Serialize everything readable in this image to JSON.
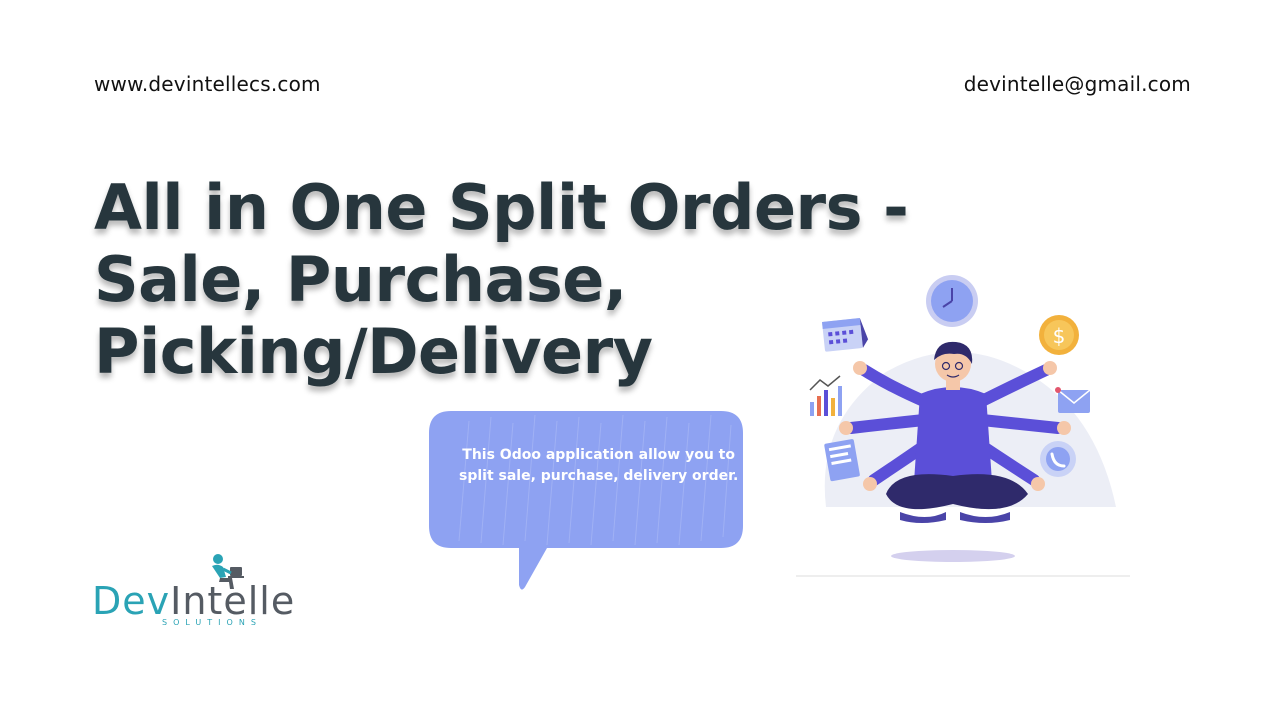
{
  "header": {
    "website": "www.devintellecs.com",
    "email": "devintelle@gmail.com"
  },
  "headline": {
    "lines": [
      "All in One Split Orders -",
      "Sale, Purchase,",
      "Picking/Delivery"
    ]
  },
  "bubble": {
    "lines": [
      "This Odoo application allow you to",
      "split sale, purchase, delivery order."
    ]
  },
  "logo": {
    "dev": "Dev",
    "intelle": "Intelle",
    "subtitle": "SOLUTIONS"
  },
  "illustration": {
    "dollar_symbol": "$"
  },
  "colors": {
    "headline": "#27363d",
    "bubble": "#8ea2f2",
    "logo_teal": "#2aa3b5",
    "logo_gray": "#555b63",
    "illustration_purple": "#5b4fd8"
  }
}
